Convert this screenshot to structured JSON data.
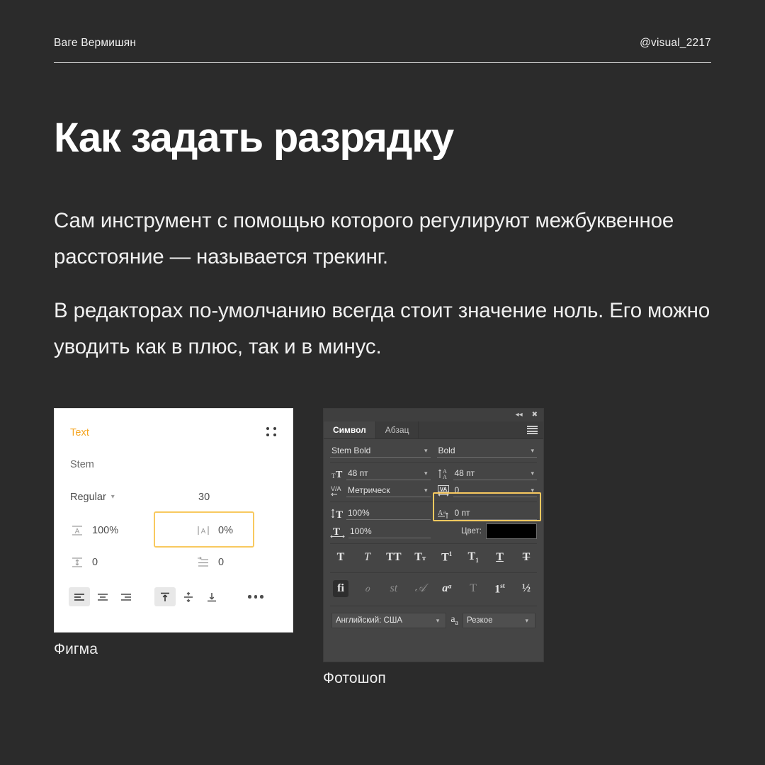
{
  "header": {
    "author": "Ваге Вермишян",
    "handle": "@visual_2217"
  },
  "title": "Как задать разрядку",
  "paragraphs": [
    "Сам инструмент с помощью которого регулируют межбуквенное расстояние — называется трекинг.",
    "В редакторах по-умолчанию всегда стоит значение ноль. Его можно уводить как в плюс, так и в минус."
  ],
  "colors": {
    "background": "#2b2b2b",
    "highlight": "#f8c95f",
    "figma_accent": "#f5a623",
    "text": "#f0f0f0"
  },
  "figma": {
    "caption": "Фигма",
    "section_label": "Text",
    "font_family": "Stem",
    "font_style": "Regular",
    "font_size": "30",
    "line_height": "100%",
    "letter_spacing": "0%",
    "paragraph_spacing": "0",
    "paragraph_indent": "0",
    "align_horizontal": [
      "align-left",
      "align-center",
      "align-right"
    ],
    "align_vertical": [
      "align-top",
      "align-middle",
      "align-bottom"
    ],
    "align_horizontal_active": "align-left",
    "align_vertical_active": "align-top",
    "more_label": "•••"
  },
  "photoshop": {
    "caption": "Фотошоп",
    "tabs": [
      {
        "label": "Символ",
        "active": true
      },
      {
        "label": "Абзац",
        "active": false
      }
    ],
    "font_family": "Stem Bold",
    "font_style": "Bold",
    "font_size": "48 пт",
    "leading": "48 пт",
    "kerning": "Метрическ",
    "tracking": "0",
    "vertical_scale": "100%",
    "horizontal_scale": "100%",
    "baseline_shift": "0 пт",
    "color_label": "Цвет:",
    "color_value": "#000000",
    "style_glyphs": [
      "T",
      "T",
      "TT",
      "Tт",
      "T¹",
      "T₁",
      "T",
      "T"
    ],
    "opentype_glyphs": [
      "fi",
      "ℴ",
      "st",
      "𝒜",
      "aa",
      "T",
      "1st",
      "½"
    ],
    "language": "Английский: США",
    "antialias": "Резкое"
  }
}
